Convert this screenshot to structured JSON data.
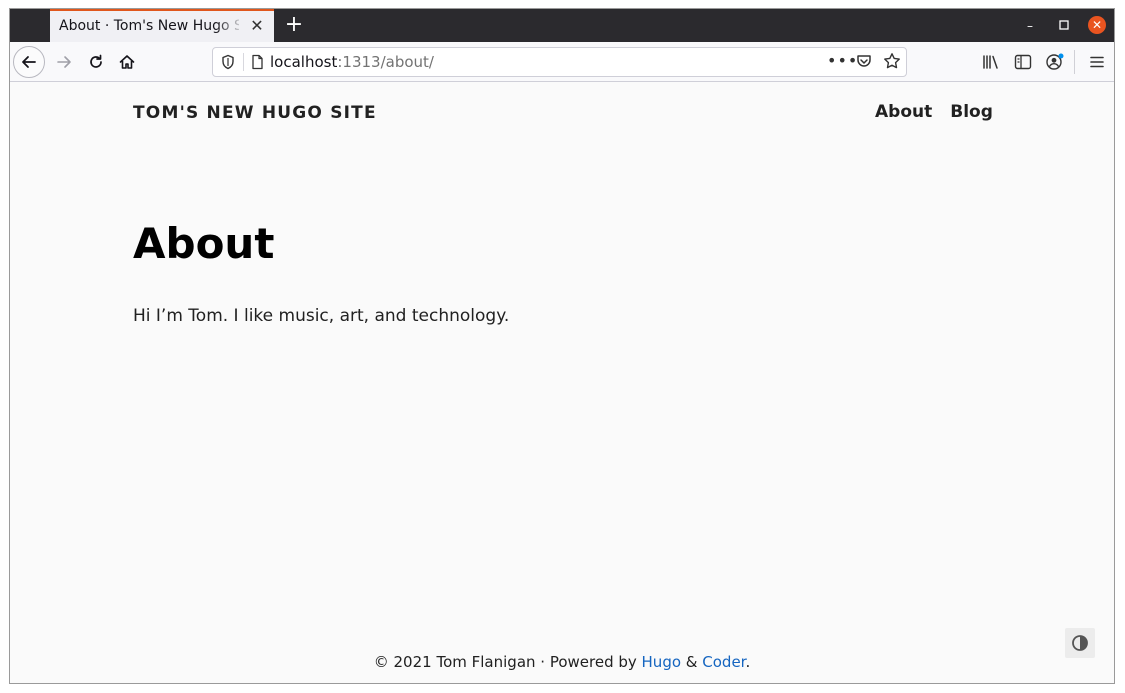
{
  "browser": {
    "tab_title": "About · Tom's New Hugo Site",
    "new_tab_label": "+",
    "url_host": "localhost",
    "url_path": ":1313/about/",
    "window_controls": {
      "minimize": "–",
      "maximize": "☐",
      "close": "✕"
    }
  },
  "site": {
    "title": "TOM'S NEW HUGO SITE",
    "nav": [
      {
        "label": "About"
      },
      {
        "label": "Blog"
      }
    ]
  },
  "content": {
    "heading": "About",
    "body": "Hi I’m Tom. I like music, art, and technology."
  },
  "footer": {
    "prefix": "© 2021 Tom Flanigan · Powered by ",
    "link1": "Hugo",
    "amp": " & ",
    "link2": "Coder",
    "suffix": "."
  },
  "colors": {
    "link": "#1565c0",
    "tab_accent": "#e0561c",
    "close_button": "#e95420"
  }
}
